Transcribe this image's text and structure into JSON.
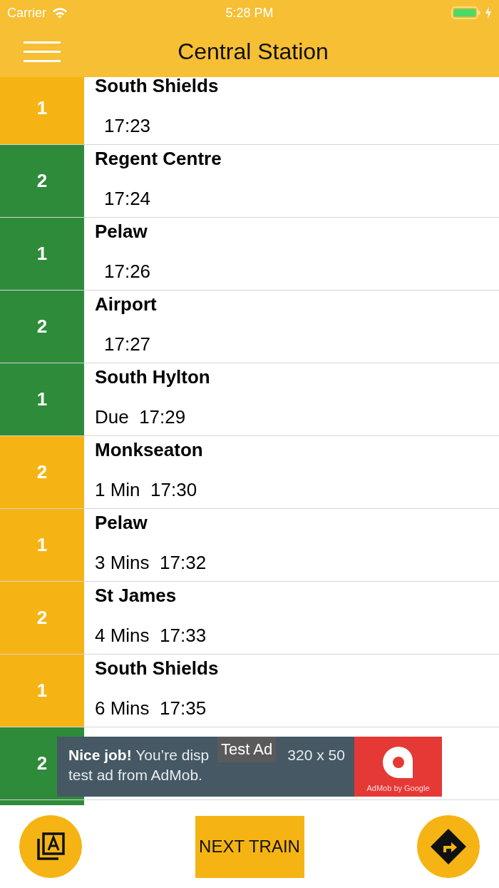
{
  "status_bar": {
    "carrier": "Carrier",
    "time": "5:28 PM"
  },
  "header": {
    "title": "Central Station"
  },
  "departures": [
    {
      "platform": "1",
      "color": "#f5b413",
      "destination": "South Shields",
      "kind": "scheduled",
      "arrival": "17:23"
    },
    {
      "platform": "2",
      "color": "#2e8b3a",
      "destination": "Regent Centre",
      "kind": "scheduled",
      "arrival": "17:24"
    },
    {
      "platform": "1",
      "color": "#2e8b3a",
      "destination": "Pelaw",
      "kind": "scheduled",
      "arrival": "17:26"
    },
    {
      "platform": "2",
      "color": "#2e8b3a",
      "destination": "Airport",
      "kind": "scheduled",
      "arrival": "17:27"
    },
    {
      "platform": "1",
      "color": "#2e8b3a",
      "destination": "South Hylton",
      "kind": "countdown",
      "arrival": "Due  17:29"
    },
    {
      "platform": "2",
      "color": "#f5b413",
      "destination": "Monkseaton",
      "kind": "countdown",
      "arrival": "1 Min  17:30"
    },
    {
      "platform": "1",
      "color": "#f5b413",
      "destination": "Pelaw",
      "kind": "countdown",
      "arrival": "3 Mins  17:32"
    },
    {
      "platform": "2",
      "color": "#f5b413",
      "destination": "St James",
      "kind": "countdown",
      "arrival": "4 Mins  17:33"
    },
    {
      "platform": "1",
      "color": "#f5b413",
      "destination": "South Shields",
      "kind": "countdown",
      "arrival": "6 Mins  17:35"
    },
    {
      "platform": "2",
      "color": "#2e8b3a"
    },
    {
      "color": "#2e8b3a"
    }
  ],
  "ad": {
    "message_start": "**Nice job!** You’re disp",
    "message_end": "320 x 50",
    "message_line2": "test ad from AdMob.",
    "label": "Test Ad",
    "brand": "AdMob by Google"
  },
  "bottom_bar": {
    "next_button": "NEXT TRAIN"
  }
}
